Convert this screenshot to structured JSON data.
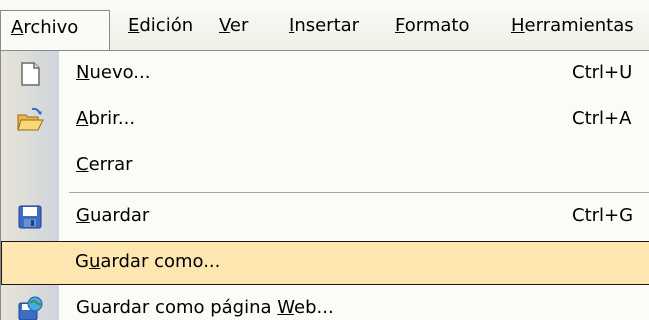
{
  "menubar": {
    "menus": [
      {
        "pre": "",
        "acc": "A",
        "post": "rchivo"
      },
      {
        "pre": "",
        "acc": "E",
        "post": "dición"
      },
      {
        "pre": "",
        "acc": "V",
        "post": "er"
      },
      {
        "pre": "",
        "acc": "I",
        "post": "nsertar"
      },
      {
        "pre": "",
        "acc": "F",
        "post": "ormato"
      },
      {
        "pre": "",
        "acc": "H",
        "post": "erramientas"
      }
    ]
  },
  "dropdown": {
    "items": [
      {
        "pre": "",
        "acc": "N",
        "post": "uevo...",
        "shortcut": "Ctrl+U",
        "icon": "new-document-icon"
      },
      {
        "pre": "",
        "acc": "A",
        "post": "brir...",
        "shortcut": "Ctrl+A",
        "icon": "open-folder-icon"
      },
      {
        "pre": "",
        "acc": "C",
        "post": "errar",
        "shortcut": "",
        "icon": ""
      },
      {
        "pre": "",
        "acc": "G",
        "post": "uardar",
        "shortcut": "Ctrl+G",
        "icon": "save-disk-icon"
      },
      {
        "pre": "G",
        "acc": "u",
        "post": "ardar como...",
        "shortcut": "",
        "icon": ""
      },
      {
        "pre": "Guardar como página ",
        "acc": "W",
        "post": "eb...",
        "shortcut": "",
        "icon": "save-as-web-icon"
      }
    ]
  },
  "colors": {
    "highlight": "#fde6b0",
    "gutter": "#dcdcd2"
  }
}
